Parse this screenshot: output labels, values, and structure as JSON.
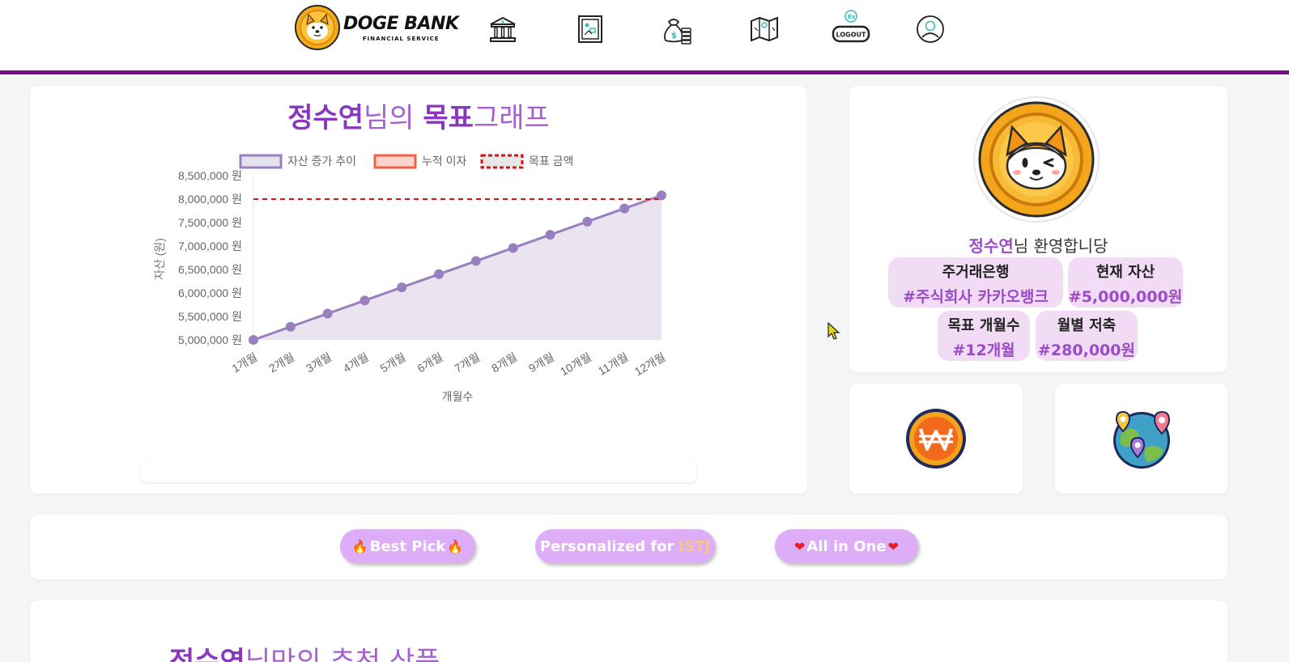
{
  "header": {
    "logo_title": "DOGE BANK",
    "logo_sub": "FINANCIAL SERVICE",
    "logout_label": "LOGOUT",
    "nav_icons": [
      "bank-icon",
      "frame-icon",
      "money-bag-icon",
      "map-icon",
      "logout-icon",
      "user-icon"
    ],
    "accent_color": "#7d0a8c"
  },
  "graph": {
    "title_name": "정수연",
    "title_mid": "님의 ",
    "title_goal": "목표",
    "title_end": "그래프",
    "progress": 0
  },
  "chart_data": {
    "type": "line",
    "categories": [
      "1개월",
      "2개월",
      "3개월",
      "4개월",
      "5개월",
      "6개월",
      "7개월",
      "8개월",
      "9개월",
      "10개월",
      "11개월",
      "12개월"
    ],
    "series": [
      {
        "name": "자산 증가 추이",
        "values": [
          5000000,
          5280000,
          5560000,
          5840000,
          6120000,
          6400000,
          6680000,
          6960000,
          7240000,
          7520000,
          7800000,
          8080000
        ],
        "color": "#9a7fbf"
      },
      {
        "name": "누적 이자",
        "values": [],
        "color": "#f06043"
      },
      {
        "name": "목표 금액",
        "values": [
          8000000,
          8000000,
          8000000,
          8000000,
          8000000,
          8000000,
          8000000,
          8000000,
          8000000,
          8000000,
          8000000,
          8000000
        ],
        "color": "#e01010"
      }
    ],
    "yticks": [
      "5,000,000 원",
      "5,500,000 원",
      "6,000,000 원",
      "6,500,000 원",
      "7,000,000 원",
      "7,500,000 원",
      "8,000,000 원",
      "8,500,000 원"
    ],
    "ylim": [
      5000000,
      8500000
    ],
    "xlabel": "개월수",
    "ylabel": "자산 (원)",
    "legend_position": "top"
  },
  "profile": {
    "name": "정수연",
    "welcome_suffix": "님 환영합니당",
    "chips": [
      {
        "label": "주거래은행",
        "value": "#주식회사 카카오뱅크"
      },
      {
        "label": "현재 자산",
        "value": "#5,000,000원"
      },
      {
        "label": "목표 개월수",
        "value": "#12개월"
      },
      {
        "label": "월별 저축",
        "value": "#280,000원"
      }
    ]
  },
  "mini": {
    "icon1": "won-coin-icon",
    "icon2": "globe-pins-icon"
  },
  "tabs": {
    "best": "Best Pick",
    "personal_prefix": "Personalized for",
    "personal_type": "ISTJ",
    "all": "All in One"
  },
  "recommend": {
    "name": "정수연",
    "suffix": "님만의 추천 상품"
  }
}
